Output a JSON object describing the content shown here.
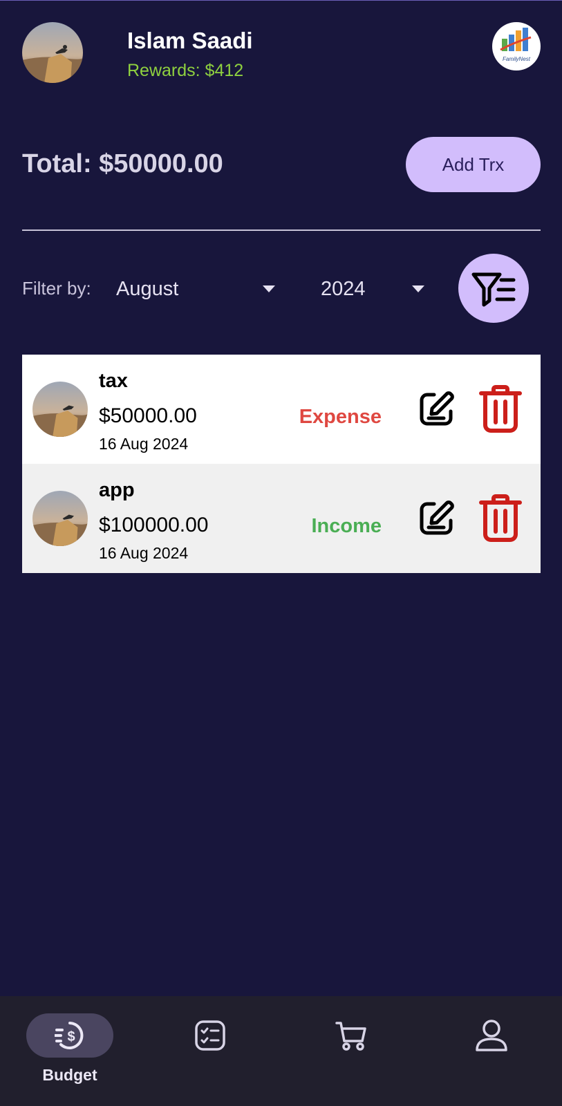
{
  "user": {
    "name": "Islam Saadi",
    "rewards": "Rewards: $412"
  },
  "logo": {
    "text": "FamilyNest"
  },
  "summary": {
    "total": "Total: $50000.00",
    "add_button": "Add Trx"
  },
  "filter": {
    "label": "Filter by:",
    "month": "August",
    "year": "2024"
  },
  "transactions": [
    {
      "title": "tax",
      "amount": "$50000.00",
      "date": "16 Aug 2024",
      "type": "Expense"
    },
    {
      "title": "app",
      "amount": "$100000.00",
      "date": "16 Aug 2024",
      "type": "Income"
    }
  ],
  "nav": {
    "items": [
      {
        "label": "Budget",
        "icon": "budget-dollar-icon",
        "active": true
      },
      {
        "label": "",
        "icon": "checklist-icon",
        "active": false
      },
      {
        "label": "",
        "icon": "cart-icon",
        "active": false
      },
      {
        "label": "",
        "icon": "profile-icon",
        "active": false
      }
    ]
  },
  "colors": {
    "background": "#18163c",
    "accent": "#d2bdfc",
    "rewards": "#8fd13f",
    "expense": "#df4841",
    "income": "#4aae54",
    "delete": "#cc1f1a",
    "nav_background": "#211f2d"
  }
}
